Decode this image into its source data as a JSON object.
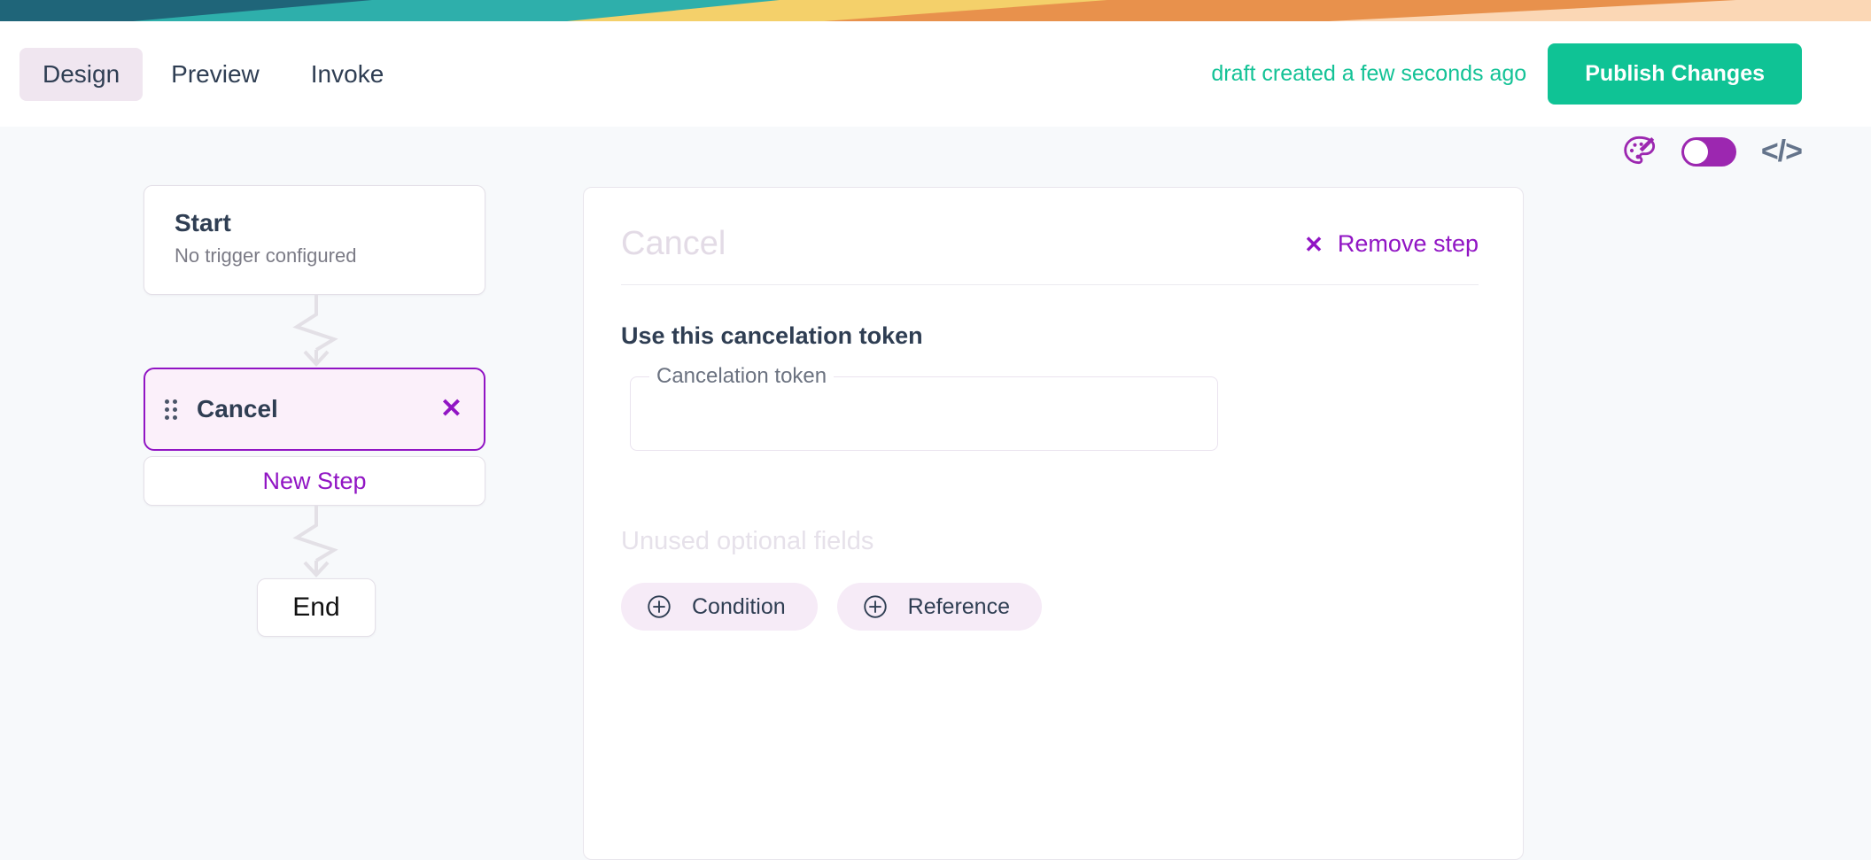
{
  "banner": {
    "colors": [
      "#1f6579",
      "#2eafab",
      "#f4d06a",
      "#e8914c",
      "#fbd7b5"
    ]
  },
  "header": {
    "tabs": [
      {
        "label": "Design",
        "active": true
      },
      {
        "label": "Preview",
        "active": false
      },
      {
        "label": "Invoke",
        "active": false
      }
    ],
    "draft_status": "draft created a few seconds ago",
    "publish_label": "Publish Changes",
    "accent_green": "#0fc395"
  },
  "toolbar": {
    "palette_icon": "palette-icon",
    "toggle_on": true,
    "code_icon": "</>",
    "accent_purple": "#9115c4"
  },
  "flow": {
    "start": {
      "title": "Start",
      "subtitle": "No trigger configured"
    },
    "step": {
      "label": "Cancel",
      "close_icon": "✕",
      "selected": true
    },
    "new_step_label": "New Step",
    "end_label": "End"
  },
  "panel": {
    "title": "Cancel",
    "remove_step_label": "Remove step",
    "remove_step_icon": "✕",
    "section_title": "Use this cancelation token",
    "field": {
      "label": "Cancelation token",
      "value": "",
      "placeholder": ""
    },
    "unused_title": "Unused optional fields",
    "chips": [
      {
        "label": "Condition",
        "icon": "plus-circle-icon"
      },
      {
        "label": "Reference",
        "icon": "plus-circle-icon"
      }
    ]
  }
}
